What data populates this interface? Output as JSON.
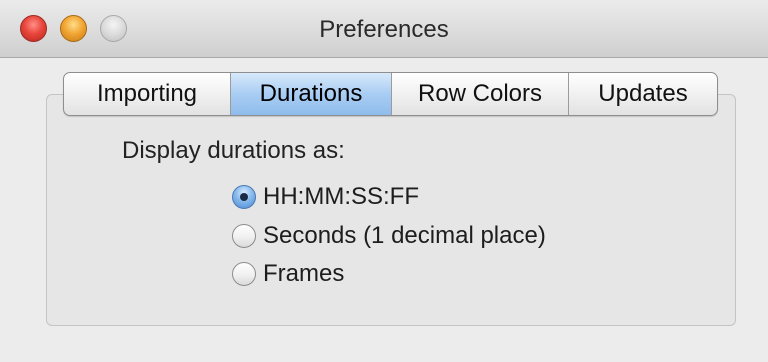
{
  "window": {
    "title": "Preferences"
  },
  "tabs": [
    {
      "label": "Importing",
      "selected": false
    },
    {
      "label": "Durations",
      "selected": true
    },
    {
      "label": "Row Colors",
      "selected": false
    },
    {
      "label": "Updates",
      "selected": false
    }
  ],
  "durations": {
    "label": "Display durations as:",
    "options": [
      {
        "label": "HH:MM:SS:FF",
        "checked": true
      },
      {
        "label": "Seconds (1 decimal place)",
        "checked": false
      },
      {
        "label": "Frames",
        "checked": false
      }
    ]
  },
  "colors": {
    "selected_tab": "#a9cdf3",
    "close": "#e8463c",
    "minimize": "#f2a634",
    "zoom": "#d8d8d8"
  }
}
